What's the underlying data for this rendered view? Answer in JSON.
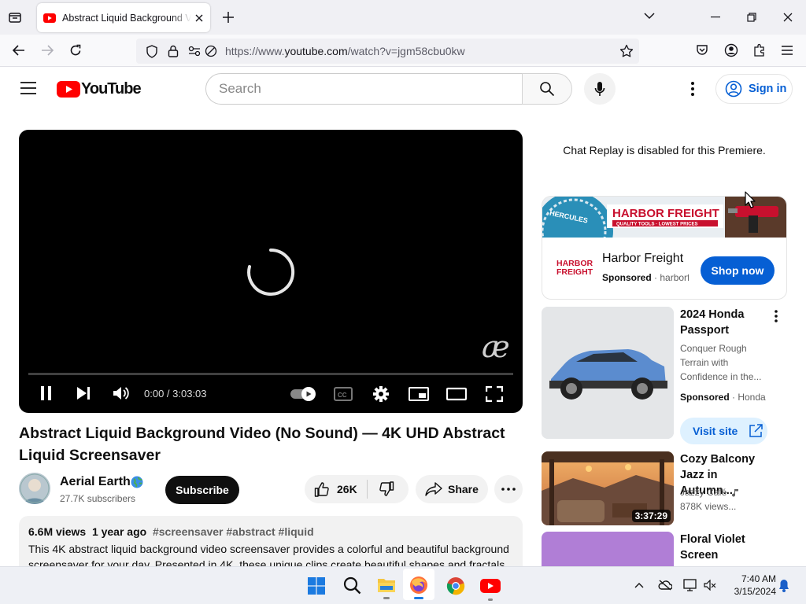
{
  "browser": {
    "tab_title": "Abstract Liquid Background Video (No Sound) — 4K UHD Abstract Liquid Screensaver",
    "url_prefix": "https://www.",
    "url_domain": "youtube.com",
    "url_path": "/watch?v=jgm58cbu0kw"
  },
  "masthead": {
    "logo_text": "YouTube",
    "search_placeholder": "Search",
    "signin_label": "Sign in"
  },
  "player": {
    "time": "0:00 / 3:03:03",
    "watermark": "æ",
    "progress_fraction": 0.0
  },
  "video": {
    "title": "Abstract Liquid Background Video (No Sound) — 4K UHD Abstract Liquid Screensaver",
    "channel_name": "Aerial Earth",
    "subscribers": "27.7K subscribers",
    "subscribe_label": "Subscribe",
    "likes": "26K",
    "share_label": "Share",
    "views": "6.6M views",
    "age": "1 year ago",
    "hashtags": "#screensaver #abstract #liquid",
    "description": "This 4K abstract liquid background video screensaver provides a colorful and beautiful background screensaver for your day. Presented in 4K, these unique clips create beautiful shapes and fractals in"
  },
  "sidebar": {
    "chat_note": "Chat Replay is disabled for this Premiere.",
    "ad1": {
      "banner_brand": "HARBOR FREIGHT",
      "banner_tagline": "QUALITY TOOLS · LOWEST PRICES",
      "banner_badge": "HERCULES",
      "logo_line1": "HARBOR",
      "logo_line2": "FREIGHT",
      "advertiser": "Harbor Freight",
      "sponsored": "Sponsored",
      "domain": "harborf",
      "cta": "Shop now"
    },
    "ad2": {
      "title": "2024 Honda Passport",
      "description": "Conquer Rough Terrain with Confidence in the...",
      "sponsored": "Sponsored",
      "advertiser": "Honda",
      "cta": "Visit site"
    },
    "videos": [
      {
        "title": "Cozy Balcony Jazz in Autumn...",
        "channel": "Jazzy Café",
        "views": "878K views...",
        "duration": "3:37:29"
      },
      {
        "title": "Floral Violet Screen"
      }
    ]
  },
  "taskbar": {
    "time": "7:40 AM",
    "date": "3/15/2024"
  },
  "colors": {
    "youtube_red": "#ff0000",
    "link_blue": "#065fd4",
    "harbor_red": "#c8102e"
  }
}
